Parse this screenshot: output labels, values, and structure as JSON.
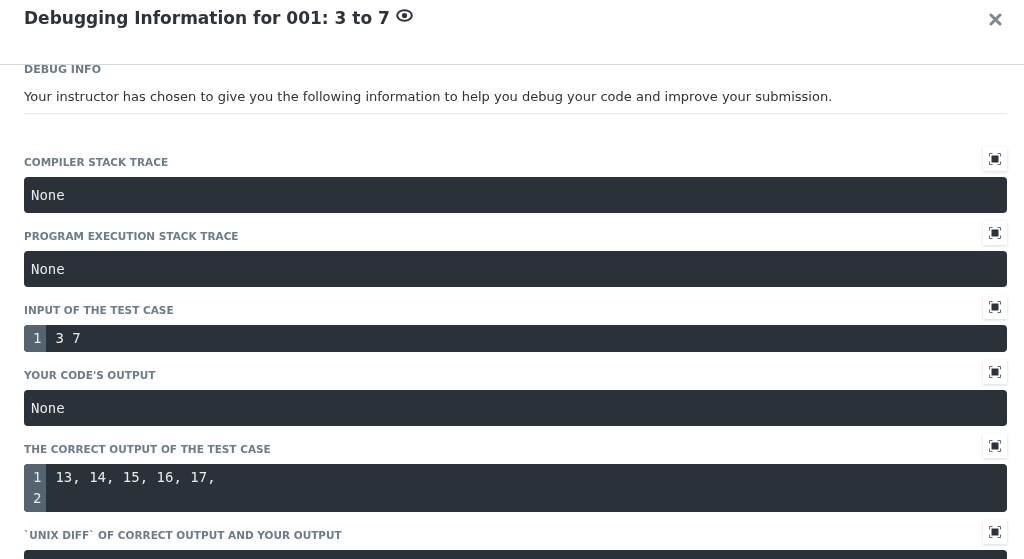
{
  "dialog": {
    "title": "Debugging Information for 001: 3 to 7",
    "section_heading": "DEBUG INFO",
    "description": "Your instructor has chosen to give you the following information to help you debug your code and improve your submission."
  },
  "sections": [
    {
      "label": "COMPILER STACK TRACE",
      "kind": "plain",
      "text": "None"
    },
    {
      "label": "PROGRAM EXECUTION STACK TRACE",
      "kind": "plain",
      "text": "None"
    },
    {
      "label": "INPUT OF THE TEST CASE",
      "kind": "code",
      "lines": [
        {
          "number": "1",
          "text": "3 7"
        }
      ]
    },
    {
      "label": "YOUR CODE'S OUTPUT",
      "kind": "plain",
      "text": "None"
    },
    {
      "label": "THE CORRECT OUTPUT OF THE TEST CASE",
      "kind": "code",
      "lines": [
        {
          "number": "1",
          "text": "13, 14, 15, 16, 17,"
        },
        {
          "number": "2"
        }
      ]
    },
    {
      "label": "`UNIX DIFF` OF CORRECT OUTPUT AND YOUR OUTPUT",
      "kind": "cut"
    }
  ]
}
